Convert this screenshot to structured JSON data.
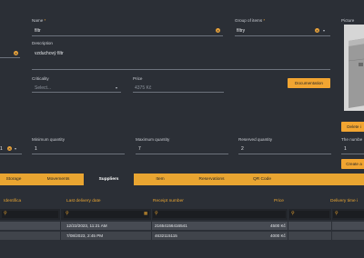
{
  "form": {
    "name_label": "Name",
    "name_required": "*",
    "name_value": "filtr",
    "group_label": "Group of items",
    "group_required": "*",
    "group_value": "filtry",
    "description_label": "Description",
    "description_value": "vzduchový filtr",
    "criticality_label": "Criticality",
    "criticality_placeholder": "Select...",
    "price_label": "Price",
    "price_value": "4375 Kč",
    "documentation_button": "Documentation",
    "picture_label": "Picture",
    "min_qty_label": "Minimum quantity",
    "min_qty_value": "1",
    "max_qty_label": "Maximum quantity",
    "max_qty_value": "7",
    "reserved_qty_label": "Reserved quantity",
    "reserved_qty_value": "2",
    "left_partial_value": "1",
    "delete_button": "Delete i",
    "the_number_label": "The numbe",
    "the_number_value": "1",
    "create_button": "Create a"
  },
  "tabs": [
    {
      "label": "Storage"
    },
    {
      "label": "Movements"
    },
    {
      "label": "Suppliers",
      "active": true
    },
    {
      "label": "Item"
    },
    {
      "label": "Reservations"
    },
    {
      "label": "QR Code"
    }
  ],
  "table": {
    "headers": [
      "Identifica",
      "Last delivery date",
      "Receipt number",
      "Price",
      "Delivery time i"
    ],
    "rows": [
      {
        "date": "12/22/2023, 11:21 AM",
        "receipt": "21654156416541",
        "price": "4500 Kč"
      },
      {
        "date": "7/08/2023, 2:45 PM",
        "receipt": "4632115115",
        "price": "4000 Kč"
      }
    ]
  },
  "colors": {
    "accent": "#e9a531",
    "background": "#2b2f36",
    "row_background": "#474b53"
  }
}
